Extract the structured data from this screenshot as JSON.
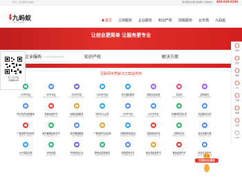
{
  "topbar": {
    "welcome": "您好，欢迎来到九蚂蚁！",
    "links": "用户服务|注册 我的账户 表单中心",
    "phone": "400-828-8200"
  },
  "logo": {
    "name": "九蚂蚁",
    "sub": "9MAYI.COM"
  },
  "nav": [
    {
      "label": "首页"
    },
    {
      "label": "工商服务"
    },
    {
      "label": "企业服务"
    },
    {
      "label": "知识产权"
    },
    {
      "label": "财税服务"
    },
    {
      "label": "云市场"
    },
    {
      "label": "九蚂蚁"
    }
  ],
  "banner": {
    "slogan": "让创业更简单 让服务更专业",
    "tabs": [
      "企业服务",
      "知识产权",
      "解决方案"
    ]
  },
  "search": {
    "placeholder": "人气商品，3万+企业都在使用的服务"
  },
  "qr": {
    "caption_line1": "扫一扫下载",
    "caption_line2": "九蚂蚁APP"
  },
  "section_title": "互联网资质解决方案提供商",
  "services": [
    {
      "title": "ICP许可证",
      "desc": "经营性网站必备资质",
      "color": "#2db46b"
    },
    {
      "title": "SP许可证",
      "desc": "增值电信业务经营许可",
      "color": "#4a8ef0"
    },
    {
      "title": "EDI许可证",
      "desc": "在线数据处理与交易",
      "color": "#7a5cf0"
    },
    {
      "title": "CDN许可证",
      "desc": "内容分发网络业务",
      "color": "#2aa2f0"
    },
    {
      "title": "多方通信服务",
      "desc": "多方通信业务许可",
      "color": "#2aa2f0"
    },
    {
      "title": "网络文化经营",
      "desc": "网络文化经营许可证",
      "color": "#a05cf0"
    },
    {
      "title": "文网文",
      "desc": "网络文化经营许可",
      "color": "#f04a6a"
    },
    {
      "title": "游戏版号",
      "desc": "网络游戏出版备案",
      "color": "#a05cf0"
    },
    {
      "title": "商业特许经营备案",
      "desc": "特许经营备案服务",
      "color": "#4a8ef0"
    },
    {
      "title": "拍卖经营许可",
      "desc": "拍卖行业资质办理",
      "color": "#e23a2e"
    },
    {
      "title": "网络出版服务",
      "desc": "网络出版服务许可证",
      "color": "#e2a22e"
    },
    {
      "title": "呼叫中心业务",
      "desc": "呼叫中心业务许可",
      "color": "#2aa2f0"
    },
    {
      "title": "ISP许可证",
      "desc": "因特网接入服务业务",
      "color": "#4a8ef0"
    },
    {
      "title": "IDC许可证",
      "desc": "互联网数据中心业务",
      "color": "#4a8ef0"
    },
    {
      "title": "存储转发类业务",
      "desc": "存储转发类业务许可",
      "color": "#2db46b"
    },
    {
      "title": "信息服务业务",
      "desc": "信息服务业务许可",
      "color": "#4a8ef0"
    },
    {
      "title": "广播电视节目制作",
      "desc": "广播电视节目制作许可",
      "color": "#e23a2e"
    },
    {
      "title": "医疗器械经营许可",
      "desc": "医疗器械经营许可证",
      "color": "#2db46b"
    },
    {
      "title": "医疗器械备案",
      "desc": "二类医疗器械备案",
      "color": "#4a8ef0"
    },
    {
      "title": "广播电视节目经营",
      "desc": "节目制作经营许可",
      "color": "#e2a22e"
    },
    {
      "title": "互联网药品信息",
      "desc": "互联网药品信息服务",
      "color": "#2aa2f0"
    },
    {
      "title": "增值电信年检",
      "desc": "增值电信年报年检",
      "color": "#e23a2e"
    },
    {
      "title": "互联网文化",
      "desc": "互联网文化经营许可",
      "color": "#2db46b"
    },
    {
      "title": "营业执照办理",
      "desc": "营业执照代办服务",
      "color": "#4a8ef0"
    },
    {
      "title": "400电话办理",
      "desc": "400电话申请办理",
      "color": "#2aa2f0"
    },
    {
      "title": "码号资源",
      "desc": "码号资源申请",
      "color": "#2db46b"
    },
    {
      "title": "外商投资企业",
      "desc": "外资增值电信许可",
      "color": "#7a5cf0"
    },
    {
      "title": "跨地区增值电信",
      "desc": "跨地区增值电信许可",
      "color": "#2db46b"
    },
    {
      "title": "网络视听许可",
      "desc": "信息网络传播视听",
      "color": "#4a8ef0"
    },
    {
      "title": "危化品经营许可",
      "desc": "危险化学品经营许可",
      "color": "#e2a22e"
    },
    {
      "title": "食品经营许可",
      "desc": "食品经营许可证",
      "color": "#e23a2e"
    },
    {
      "title": "安全生产许可",
      "desc": "安全生产许可证办理",
      "color": "#4a8ef0"
    }
  ],
  "sidebar": [
    {
      "label": "电话",
      "icon": "phone-icon"
    },
    {
      "label": "在线",
      "icon": "chat-icon"
    },
    {
      "label": "微信",
      "icon": "wechat-icon"
    },
    {
      "label": "QQ",
      "icon": "qq-icon"
    },
    {
      "label": "订单",
      "icon": "order-icon"
    },
    {
      "label": "收藏",
      "icon": "star-icon"
    },
    {
      "label": "反馈",
      "icon": "feedback-icon"
    },
    {
      "label": "TOP",
      "icon": "arrow-up-icon"
    }
  ],
  "float_badge": {
    "label": "在线找代办服务"
  },
  "colors": {
    "brand_red": "#e23a2e",
    "banner_red": "#d41f1f"
  }
}
